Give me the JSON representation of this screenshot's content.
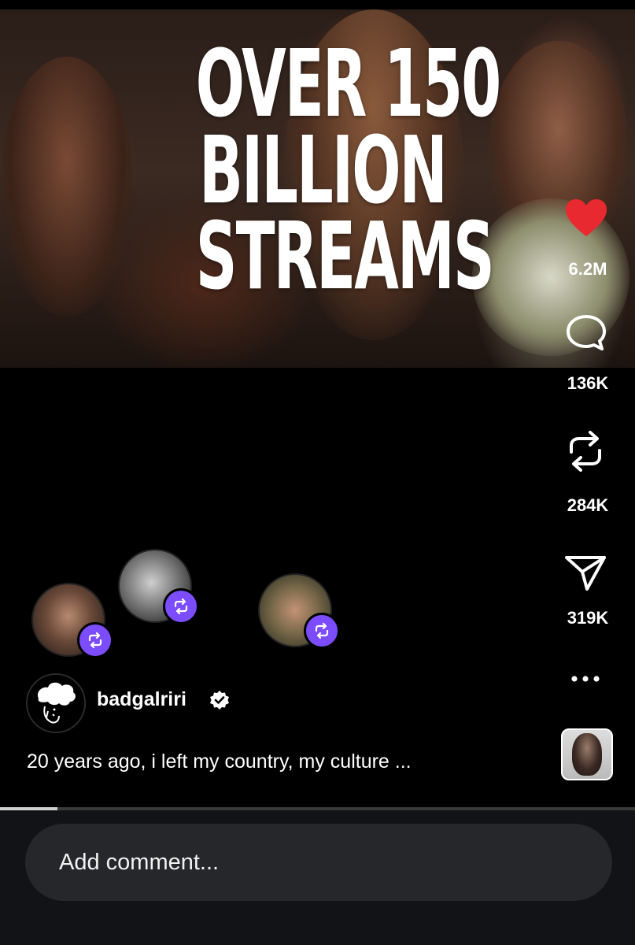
{
  "video": {
    "headline_lines": [
      "OVER 150",
      "BILLION",
      "STREAMS"
    ]
  },
  "actions": {
    "like": {
      "icon": "heart-icon",
      "count": "6.2M",
      "color": "#e8292f"
    },
    "comment": {
      "icon": "comment-bubble-icon",
      "count": "136K"
    },
    "repost": {
      "icon": "repost-icon",
      "count": "284K"
    },
    "share": {
      "icon": "paper-plane-icon",
      "count": "319K"
    },
    "more": {
      "icon": "more-dots-icon"
    }
  },
  "reposters": [
    {
      "name": "reposter-avatar-1",
      "badge_icon": "repost-badge-icon"
    },
    {
      "name": "reposter-avatar-2",
      "badge_icon": "repost-badge-icon"
    },
    {
      "name": "reposter-avatar-3",
      "badge_icon": "repost-badge-icon"
    }
  ],
  "author": {
    "username": "badgalriri",
    "verified": true
  },
  "caption": "20 years ago, i left my country, my culture ...",
  "playback": {
    "progress": 0.09
  },
  "comment_box": {
    "placeholder": "Add comment..."
  },
  "colors": {
    "accent_badge": "#7c4dff",
    "background": "#000000",
    "comment_bar": "#121316"
  }
}
